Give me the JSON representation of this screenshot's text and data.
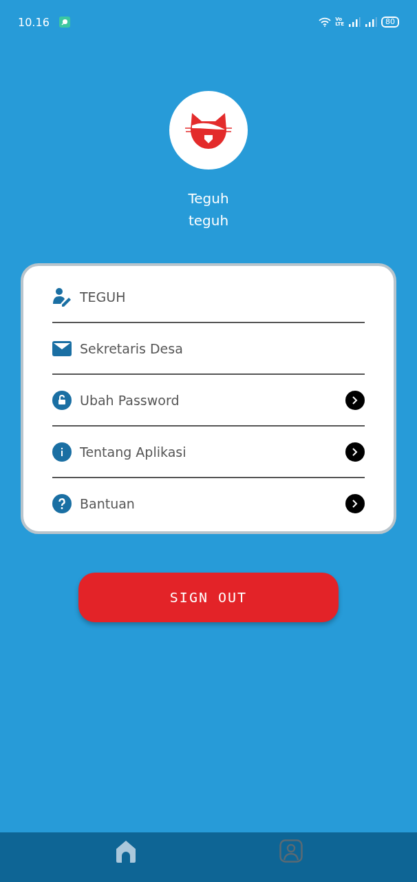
{
  "status_bar": {
    "time": "10.16",
    "network_top": "Vo",
    "network_bottom": "LTE",
    "battery": "80"
  },
  "profile": {
    "name": "Teguh",
    "username": "teguh"
  },
  "menu": [
    {
      "kind": "field",
      "label": "TEGUH"
    },
    {
      "kind": "field",
      "label": "Sekretaris Desa"
    },
    {
      "kind": "link",
      "label": "Ubah Password"
    },
    {
      "kind": "link",
      "label": "Tentang Aplikasi"
    },
    {
      "kind": "link",
      "label": "Bantuan"
    }
  ],
  "sign_out": {
    "label": "SIGN OUT"
  },
  "bottom_nav": [
    {
      "kind": "home",
      "selected": true
    },
    {
      "kind": "profile",
      "selected": false
    }
  ]
}
